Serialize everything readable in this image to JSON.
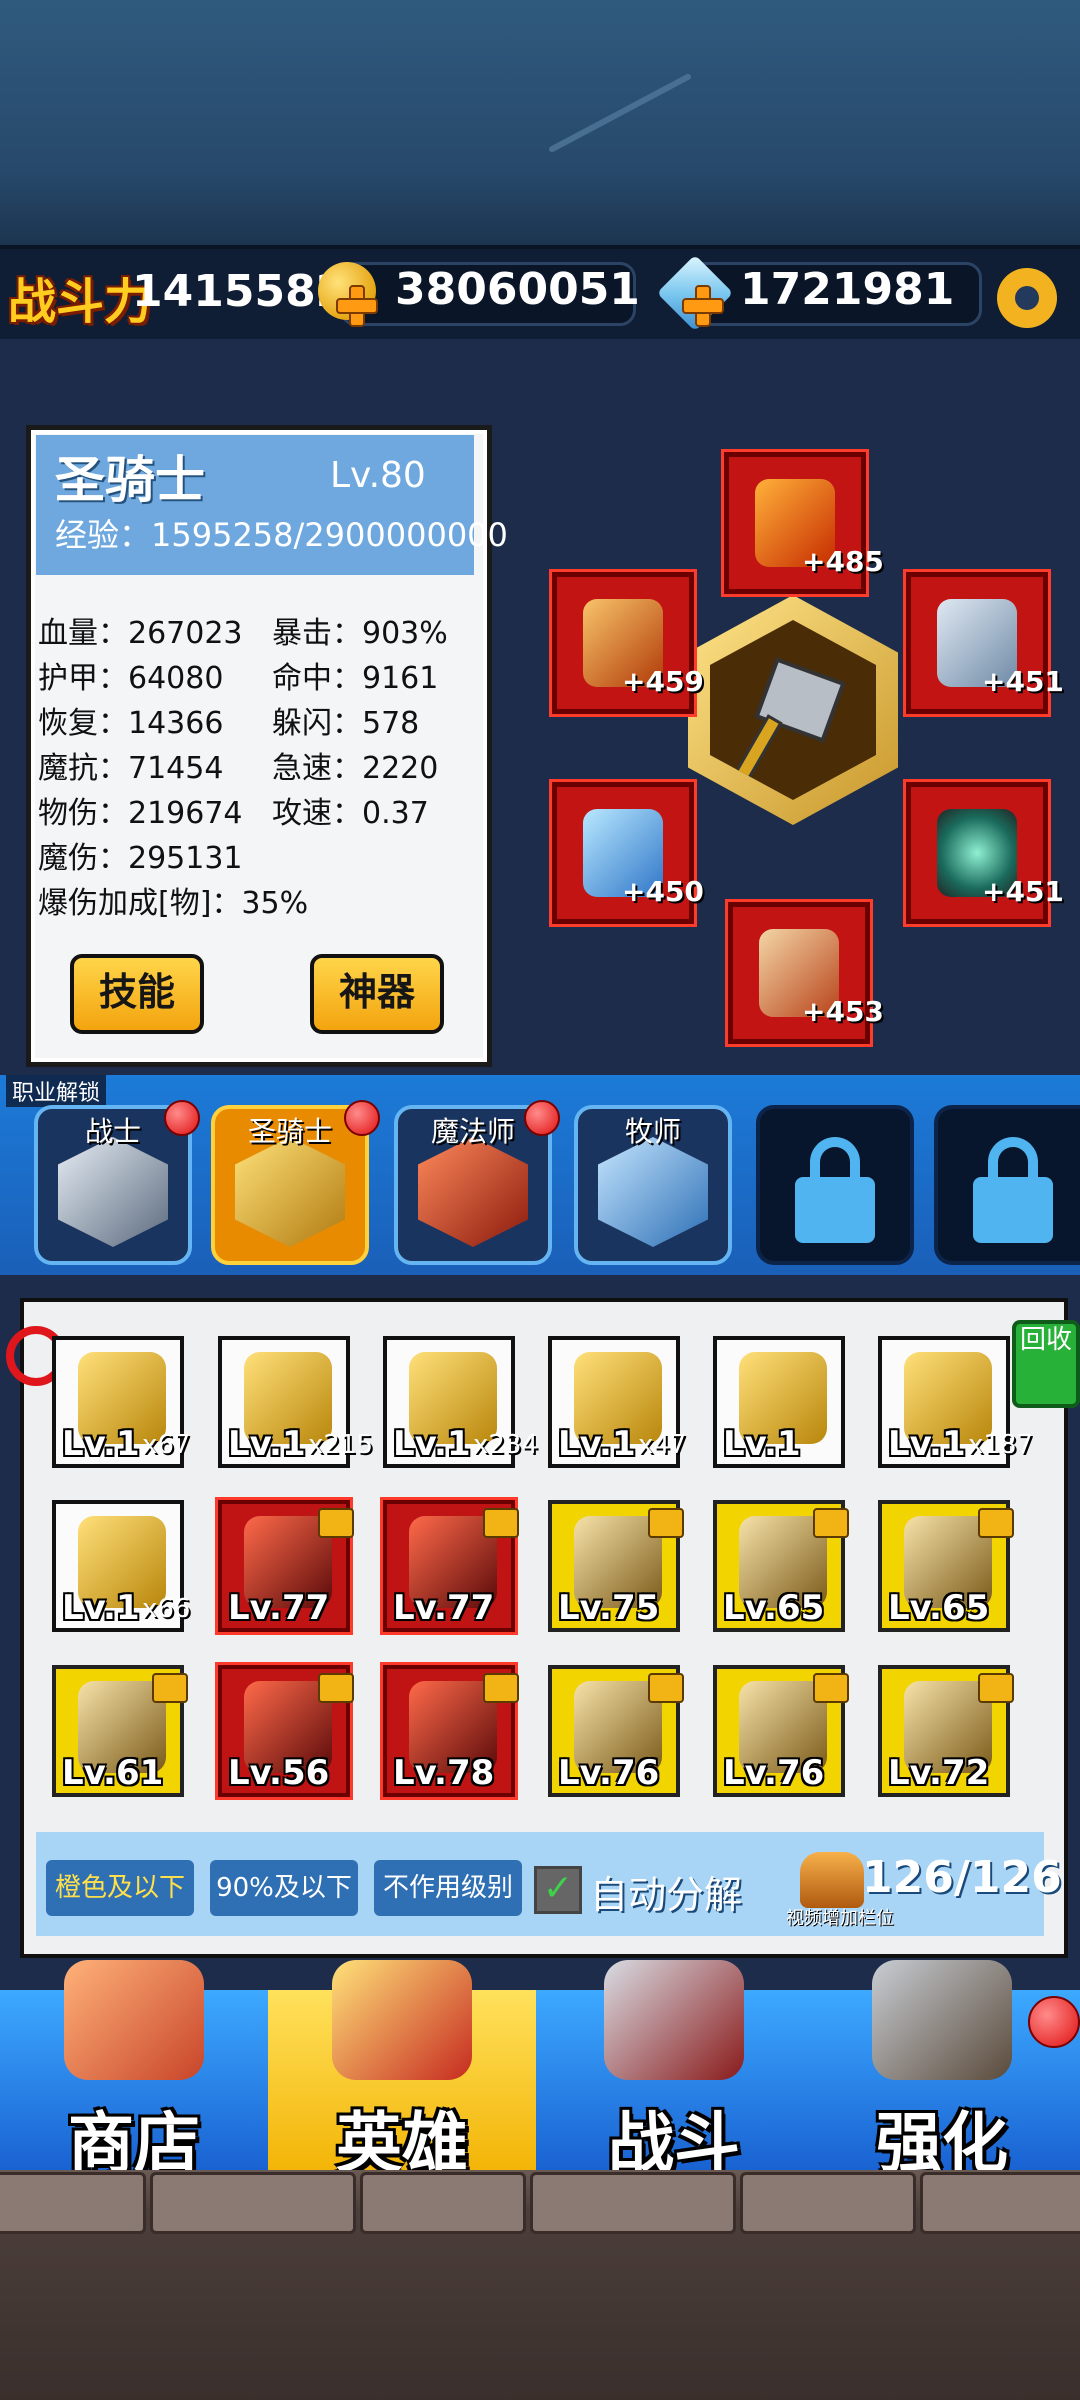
{
  "top_bar": {
    "power_label": "战斗力",
    "power_value": "14155820",
    "gold_value": "38060051",
    "diamond_value": "1721981",
    "icons": [
      "gold-coin-icon",
      "diamond-icon",
      "settings-gear-icon"
    ]
  },
  "hero": {
    "name": "圣骑士",
    "level": "Lv.80",
    "exp": "经验：1595258/2900000000",
    "stats": [
      "血量：267023",
      "暴击：903%",
      "护甲：64080",
      "命中：9161",
      "恢复：14366",
      "躲闪：578",
      "魔抗：71454",
      "急速：2220",
      "物伤：219674",
      "攻速：0.37",
      "魔伤：295131",
      "",
      "爆伤加成[物]：35%",
      ""
    ],
    "skill_button": "技能",
    "artifact_button": "神器"
  },
  "equipment": {
    "helmet": "+485",
    "armor": "+459",
    "weapon": "+451",
    "amulet": "+450",
    "ring": "+451",
    "boots": "+453"
  },
  "classes": {
    "unlock_label": "职业解锁",
    "items": [
      {
        "label": "战士",
        "state": "normal",
        "dot": true
      },
      {
        "label": "圣骑士",
        "state": "selected",
        "dot": true
      },
      {
        "label": "魔法师",
        "state": "normal",
        "dot": true
      },
      {
        "label": "牧师",
        "state": "normal",
        "dot": false
      },
      {
        "label": "",
        "state": "locked",
        "dot": false
      },
      {
        "label": "",
        "state": "locked",
        "dot": false
      }
    ]
  },
  "inventory": {
    "recycle_label": "回收",
    "rows": [
      [
        {
          "lv": "Lv.1",
          "count": "x67",
          "frame": "white",
          "locked": false
        },
        {
          "lv": "Lv.1",
          "count": "x215",
          "frame": "white",
          "locked": false
        },
        {
          "lv": "Lv.1",
          "count": "x234",
          "frame": "white",
          "locked": false
        },
        {
          "lv": "Lv.1",
          "count": "x47",
          "frame": "white",
          "locked": false
        },
        {
          "lv": "Lv.1",
          "count": "",
          "frame": "white",
          "locked": false
        },
        {
          "lv": "Lv.1",
          "count": "x187",
          "frame": "white",
          "locked": false
        }
      ],
      [
        {
          "lv": "Lv.1",
          "count": "x66",
          "frame": "white",
          "locked": false
        },
        {
          "lv": "Lv.77",
          "count": "",
          "frame": "red",
          "locked": true
        },
        {
          "lv": "Lv.77",
          "count": "",
          "frame": "red",
          "locked": true
        },
        {
          "lv": "Lv.75",
          "count": "",
          "frame": "yellow",
          "locked": true
        },
        {
          "lv": "Lv.65",
          "count": "",
          "frame": "yellow",
          "locked": true
        },
        {
          "lv": "Lv.65",
          "count": "",
          "frame": "yellow",
          "locked": true
        }
      ],
      [
        {
          "lv": "Lv.61",
          "count": "",
          "frame": "yellow",
          "locked": true
        },
        {
          "lv": "Lv.56",
          "count": "",
          "frame": "red",
          "locked": true
        },
        {
          "lv": "Lv.78",
          "count": "",
          "frame": "red",
          "locked": true
        },
        {
          "lv": "Lv.76",
          "count": "",
          "frame": "yellow",
          "locked": true
        },
        {
          "lv": "Lv.76",
          "count": "",
          "frame": "yellow",
          "locked": true
        },
        {
          "lv": "Lv.72",
          "count": "",
          "frame": "yellow",
          "locked": true
        }
      ]
    ],
    "filters": [
      "橙色及以下",
      "90%及以下",
      "不作用级别"
    ],
    "auto_decompose": "自动分解",
    "capacity": "126/126",
    "video_add_slots": "视频增加栏位"
  },
  "nav": [
    {
      "label": "商店",
      "selected": false
    },
    {
      "label": "英雄",
      "selected": true
    },
    {
      "label": "战斗",
      "selected": false
    },
    {
      "label": "强化",
      "selected": false
    }
  ],
  "colors": {
    "accent_gold": "#ffcc20",
    "selected_orange": "#e98b00",
    "rarity_red": "#c01414",
    "rarity_yellow": "#f1d400",
    "nav_blue": "#1962d2"
  }
}
